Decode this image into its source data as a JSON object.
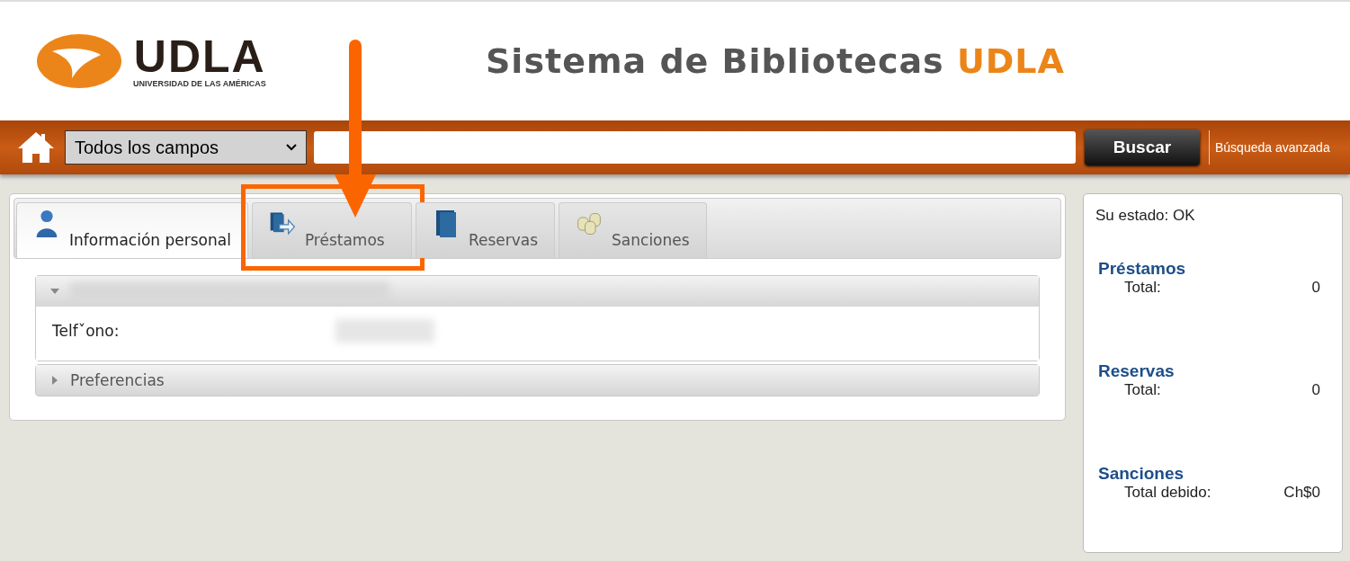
{
  "header": {
    "logo_word": "UDLA",
    "logo_tagline": "UNIVERSIDAD DE LAS AMÉRICAS",
    "title": "Sistema de Bibliotecas ",
    "title_accent": "UDLA"
  },
  "search_bar": {
    "field_select": "Todos los campos",
    "button": "Buscar",
    "advanced_link": "Búsqueda avanzada"
  },
  "tabs": [
    {
      "label": "Información personal",
      "kind": "person",
      "selected": true,
      "highlighted": false
    },
    {
      "label": "Préstamos",
      "kind": "loan",
      "selected": false,
      "highlighted": true
    },
    {
      "label": "Reservas",
      "kind": "book",
      "selected": false,
      "highlighted": false
    },
    {
      "label": "Sanciones",
      "kind": "coins",
      "selected": false,
      "highlighted": false
    }
  ],
  "sections": [
    {
      "expanded": true,
      "fields": [
        {
          "label": "Telfˇono:"
        }
      ]
    },
    {
      "title": "Preferencias",
      "expanded": false
    }
  ],
  "summary": {
    "status": "Su estado: OK",
    "groups": [
      {
        "title": "Préstamos",
        "label": "Total:",
        "value": "0"
      },
      {
        "title": "Reservas",
        "label": "Total:",
        "value": "0"
      },
      {
        "title": "Sanciones",
        "label": "Total debido:",
        "value": "Ch$0"
      }
    ]
  }
}
